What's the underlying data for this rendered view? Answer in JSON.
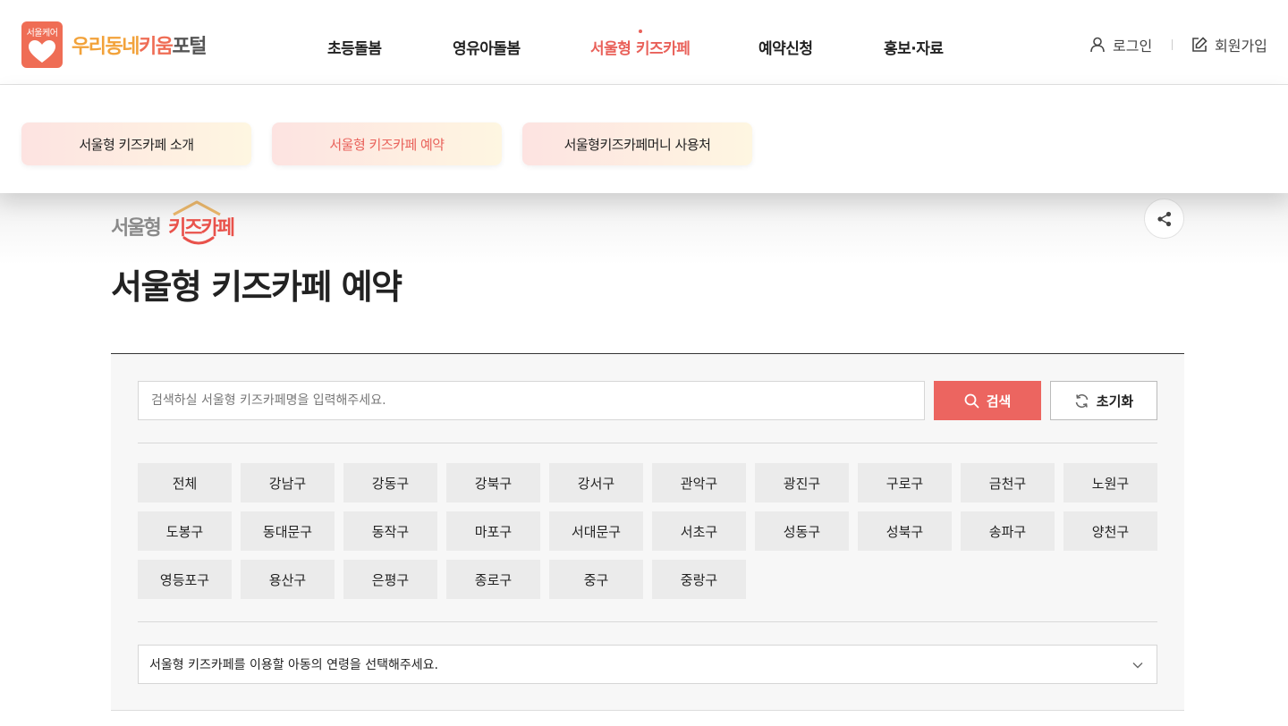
{
  "header": {
    "logo_badge": "서울케어",
    "logo_text_part1": "우리동네",
    "logo_text_part2": "키움",
    "logo_text_part3": "포털",
    "nav": [
      "초등돌봄",
      "영유아돌봄",
      "서울형 키즈카페",
      "예약신청",
      "홍보·자료"
    ],
    "active_nav_index": 2,
    "login": "로그인",
    "signup": "회원가입"
  },
  "subnav": {
    "items": [
      "서울형 키즈카페 소개",
      "서울형 키즈카페 예약",
      "서울형키즈카페머니 사용처"
    ],
    "active_index": 1
  },
  "page": {
    "logo_text_a": "서울형",
    "logo_text_b": "키즈카페",
    "title": "서울형 키즈카페 예약"
  },
  "search": {
    "placeholder": "검색하실 서울형 키즈카페명을 입력해주세요.",
    "search_label": "검색",
    "reset_label": "초기화"
  },
  "districts": [
    "전체",
    "강남구",
    "강동구",
    "강북구",
    "강서구",
    "관악구",
    "광진구",
    "구로구",
    "금천구",
    "노원구",
    "도봉구",
    "동대문구",
    "동작구",
    "마포구",
    "서대문구",
    "서초구",
    "성동구",
    "성북구",
    "송파구",
    "양천구",
    "영등포구",
    "용산구",
    "은평구",
    "종로구",
    "중구",
    "중랑구"
  ],
  "age_select": {
    "placeholder": "서울형 키즈카페를 이용할 아동의 연령을 선택해주세요."
  },
  "colors": {
    "accent": "#ec6560",
    "brand_orange": "#f2a23a",
    "brand_red": "#ef6d55"
  }
}
